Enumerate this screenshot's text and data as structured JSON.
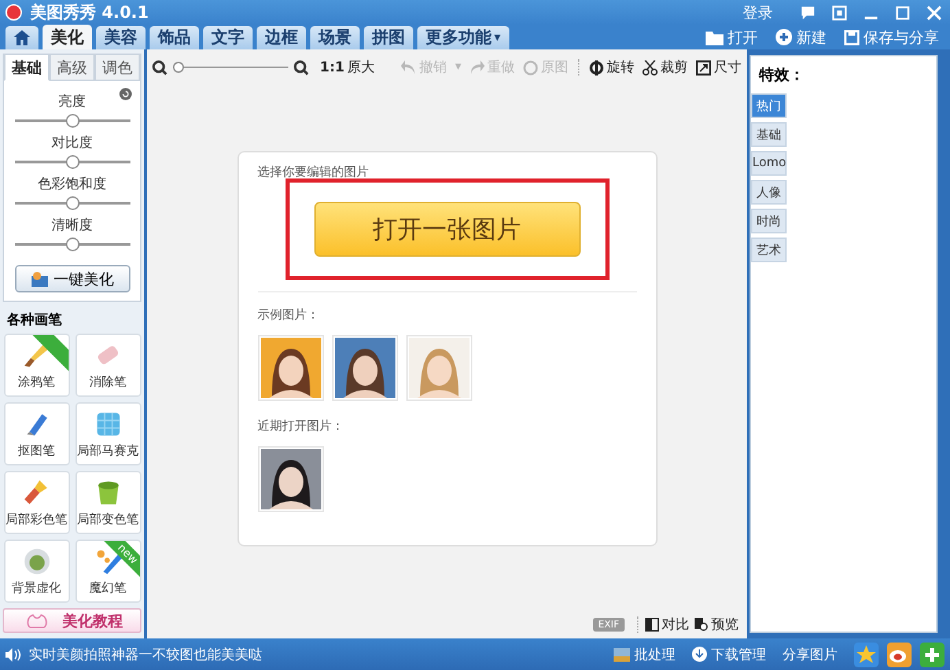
{
  "window": {
    "title": "美图秀秀 4.0.1",
    "login": "登录"
  },
  "tabs": [
    {
      "label": "美化",
      "selected": true
    },
    {
      "label": "美容",
      "selected": false
    },
    {
      "label": "饰品",
      "selected": false
    },
    {
      "label": "文字",
      "selected": false
    },
    {
      "label": "边框",
      "selected": false
    },
    {
      "label": "场景",
      "selected": false
    },
    {
      "label": "拼图",
      "selected": false
    },
    {
      "label": "更多功能",
      "selected": false,
      "caret": "▾"
    }
  ],
  "top_actions": [
    "打开",
    "新建",
    "保存与分享"
  ],
  "left_panel": {
    "tabs": [
      {
        "label": "基础",
        "selected": true
      },
      {
        "label": "高级",
        "selected": false
      },
      {
        "label": "调色",
        "selected": false
      }
    ],
    "sliders": [
      {
        "label": "亮度",
        "level": 0.5
      },
      {
        "label": "对比度",
        "level": 0.5
      },
      {
        "label": "色彩饱和度",
        "level": 0.5
      },
      {
        "label": "清晰度",
        "level": 0.5
      }
    ],
    "auto_button": "一键美化",
    "brushes_title": "各种画笔",
    "brushes": [
      {
        "label": "涂鸦笔",
        "ribbon": true
      },
      {
        "label": "消除笔",
        "ribbon": false
      },
      {
        "label": "抠图笔",
        "ribbon": false
      },
      {
        "label": "局部马赛克",
        "ribbon": false
      },
      {
        "label": "局部彩色笔",
        "ribbon": false
      },
      {
        "label": "局部变色笔",
        "ribbon": false
      },
      {
        "label": "背景虚化",
        "ribbon": false
      },
      {
        "label": "魔幻笔",
        "ribbon": true,
        "ribbon_text": "new"
      }
    ],
    "tutorial_button": "美化教程"
  },
  "toolbar": {
    "zoom": {
      "level": 0
    },
    "actual_size_ratio": "1:1",
    "actual_size": "原大",
    "actions": [
      {
        "label": "撤销",
        "disabled": true,
        "caret": "▾"
      },
      {
        "label": "重做",
        "disabled": true
      },
      {
        "label": "原图",
        "disabled": true
      },
      {
        "label": "旋转",
        "disabled": false
      },
      {
        "label": "裁剪",
        "disabled": false
      },
      {
        "label": "尺寸",
        "disabled": false
      }
    ]
  },
  "card": {
    "prompt": "选择你要编辑的图片",
    "open_button": "打开一张图片",
    "highlighted": true,
    "samples_label": "示例图片：",
    "recent_label": "近期打开图片："
  },
  "bottom_tools": {
    "exif": "EXIF",
    "compare": "对比",
    "preview": "预览"
  },
  "effects": {
    "title": "特效：",
    "tabs": [
      {
        "label": "热门",
        "selected": true
      },
      {
        "label": "基础",
        "selected": false
      },
      {
        "label": "Lomo",
        "selected": false
      },
      {
        "label": "人像",
        "selected": false
      },
      {
        "label": "时尚",
        "selected": false
      },
      {
        "label": "艺术",
        "selected": false
      }
    ]
  },
  "status_bar": {
    "message": "实时美颜拍照神器一不较图也能美美哒",
    "actions": [
      "批处理",
      "下载管理",
      "分享图片"
    ]
  }
}
